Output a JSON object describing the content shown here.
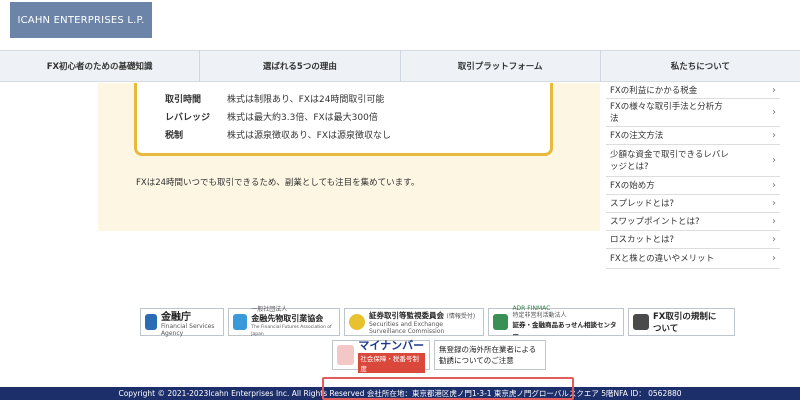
{
  "header": {
    "logo_text": "ICAHN ENTERPRISES L.P."
  },
  "nav": {
    "items": [
      {
        "label": "FX初心者のための基礎知識"
      },
      {
        "label": "選ばれる5つの理由"
      },
      {
        "label": "取引プラットフォーム"
      },
      {
        "label": "私たちについて"
      }
    ]
  },
  "content": {
    "table": [
      {
        "label": "取引時間",
        "value": "株式は制限あり、FXは24時間取引可能"
      },
      {
        "label": "レバレッジ",
        "value": "株式は最大約3.3倍、FXは最大300倍"
      },
      {
        "label": "税制",
        "value": "株式は源泉徴収あり、FXは源泉徴収なし"
      }
    ],
    "note": "FXは24時間いつでも取引できるため、副業としても注目を集めています。"
  },
  "sidebar": {
    "items": [
      {
        "label": "FXの利益にかかる税金"
      },
      {
        "label": "FXの様々な取引手法と分析方法"
      },
      {
        "label": "FXの注文方法"
      },
      {
        "label": "少額な資金で取引できるレバレッジとは?"
      },
      {
        "label": "FXの始め方"
      },
      {
        "label": "スプレッドとは?"
      },
      {
        "label": "スワップポイントとは?"
      },
      {
        "label": "ロスカットとは?"
      },
      {
        "label": "FXと株との違いやメリット"
      }
    ]
  },
  "banners": {
    "fsa": {
      "title": "金融庁",
      "sub": "Financial Services Agency"
    },
    "ffaj": {
      "title": "金融先物取引業協会",
      "pre": "一般社団法人",
      "sub": "The Financial Futures Association of Japan"
    },
    "sesc": {
      "title": "証券取引等監視委員会",
      "tag": "(情報受付)",
      "sub1": "Securities and Exchange",
      "sub2": "Surveillance Commission"
    },
    "finmac": {
      "title": "証券・金融商品あっせん相談センター",
      "pre1": "ADR FINMAC",
      "pre2": "特定非営利活動法人"
    },
    "fxreg": {
      "line1": "FX取引の規制に",
      "line2": "ついて"
    },
    "mynumber": {
      "title": "マイナンバー",
      "sub": "社会保障・税番号制度"
    },
    "unreg": {
      "line1": "無登録の海外所在業者による",
      "line2": "勧誘についてのご注意"
    }
  },
  "footer": {
    "text": "Copyright © 2021-2023Icahn Enterprises Inc. All Rights Reserved 会社所在地：東京都港区虎ノ門1-3-1 東京虎ノ門グローバルスクエア 5階NFA ID： 0562880"
  }
}
